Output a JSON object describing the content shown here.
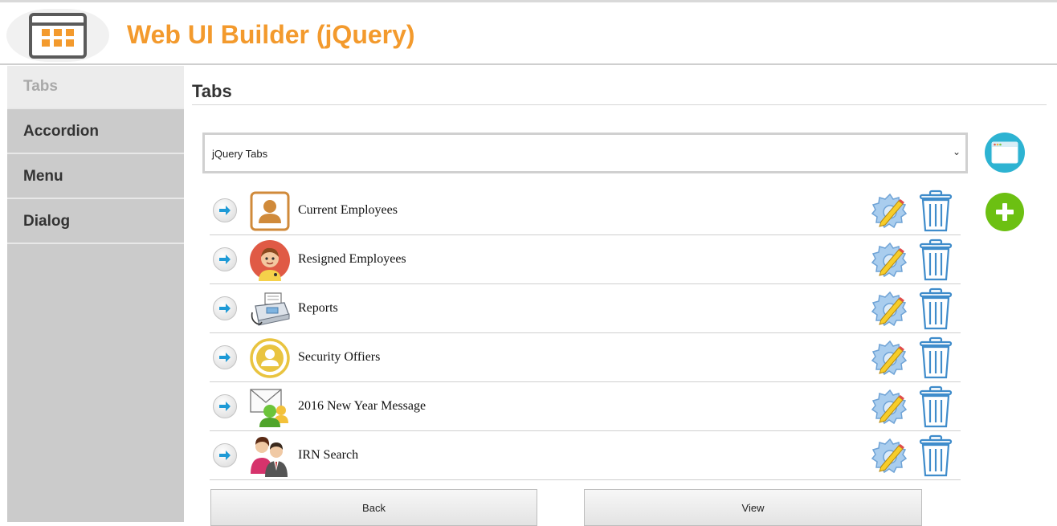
{
  "app": {
    "title": "Web UI Builder (jQuery)"
  },
  "sidebar": {
    "items": [
      {
        "label": "Tabs",
        "active": true
      },
      {
        "label": "Accordion",
        "active": false
      },
      {
        "label": "Menu",
        "active": false
      },
      {
        "label": "Dialog",
        "active": false
      }
    ]
  },
  "main": {
    "title": "Tabs",
    "select": {
      "value": "jQuery Tabs"
    },
    "rows": [
      {
        "label": "Current Employees",
        "icon": "person-card-icon"
      },
      {
        "label": "Resigned Employees",
        "icon": "child-face-icon"
      },
      {
        "label": "Reports",
        "icon": "fax-machine-icon"
      },
      {
        "label": "Security Offiers",
        "icon": "user-circle-icon"
      },
      {
        "label": "2016 New Year Message",
        "icon": "mail-user-icon"
      },
      {
        "label": "IRN Search",
        "icon": "people-icon"
      }
    ],
    "buttons": {
      "back": "Back",
      "view": "View"
    }
  },
  "colors": {
    "accent": "#f39a2d",
    "window_button": "#2db3d2",
    "add_button": "#6cc012",
    "sidebar": "#cbcbcb"
  }
}
